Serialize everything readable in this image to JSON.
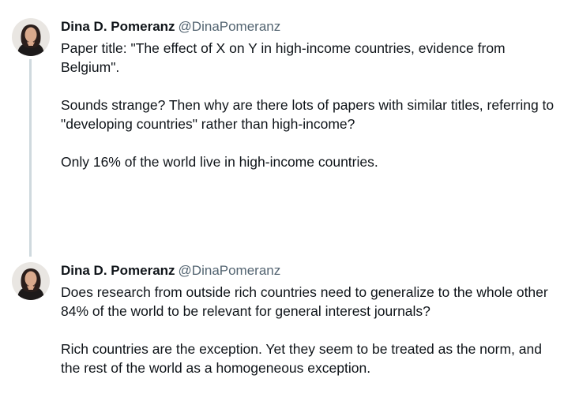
{
  "thread": [
    {
      "author": {
        "name": "Dina D. Pomeranz",
        "handle": "@DinaPomeranz"
      },
      "paragraphs": [
        "Paper title: \"The effect of X on Y in high-income countries, evidence from Belgium\".",
        "Sounds strange? Then why are there lots of papers with similar titles, referring to \"developing countries\" rather than high-income?",
        "Only 16% of the world live in high-income countries."
      ]
    },
    {
      "author": {
        "name": "Dina D. Pomeranz",
        "handle": "@DinaPomeranz"
      },
      "paragraphs": [
        "Does research from outside rich countries need to generalize to the whole other 84% of the world to be relevant for general interest journals?",
        "Rich countries are the exception. Yet they seem to be treated as the norm, and the rest of the world as a homogeneous exception."
      ]
    }
  ],
  "colors": {
    "text": "#0f1419",
    "secondary_text": "#536471",
    "thread_line": "#cfd9de",
    "background": "#ffffff"
  }
}
